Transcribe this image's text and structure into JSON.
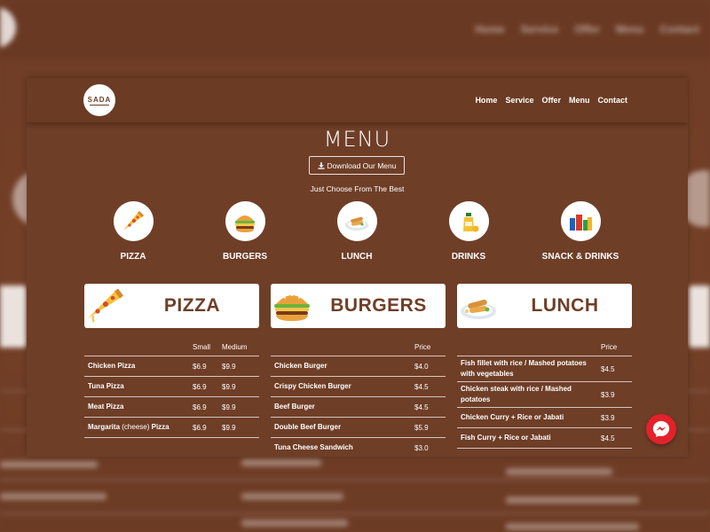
{
  "brand": {
    "logo_text": "SADA"
  },
  "nav": [
    "Home",
    "Service",
    "Offer",
    "Menu",
    "Contact"
  ],
  "menu_title": "MENU",
  "download_label": "Download Our Menu",
  "subtitle": "Just Choose From The Best",
  "categories": [
    {
      "label": "PIZZA",
      "icon": "pizza-icon"
    },
    {
      "label": "BURGERS",
      "icon": "burger-icon"
    },
    {
      "label": "LUNCH",
      "icon": "lunch-icon"
    },
    {
      "label": "DRINKS",
      "icon": "drinks-icon"
    },
    {
      "label": "SNACK & DRINKS",
      "icon": "snacks-icon"
    }
  ],
  "sections": {
    "pizza": {
      "title": "PIZZA",
      "headers": [
        "Small",
        "Medium"
      ],
      "items": [
        {
          "name": "Chicken Pizza",
          "small": "$6.9",
          "medium": "$9.9"
        },
        {
          "name": "Tuna Pizza",
          "small": "$6.9",
          "medium": "$9.9"
        },
        {
          "name": "Meat Pizza",
          "small": "$6.9",
          "medium": "$9.9"
        },
        {
          "name_bold": "Margarita",
          "name_thin": "(cheese)",
          "name_tail": "Pizza",
          "small": "$6.9",
          "medium": "$9.9"
        }
      ]
    },
    "burgers": {
      "title": "BURGERS",
      "header": "Price",
      "items": [
        {
          "name": "Chicken Burger",
          "price": "$4.0"
        },
        {
          "name": "Crispy Chicken Burger",
          "price": "$4.5"
        },
        {
          "name": "Beef Burger",
          "price": "$4.5"
        },
        {
          "name": "Double Beef Burger",
          "price": "$5.9"
        },
        {
          "name": "Tuna Cheese Sandwich",
          "price": "$3.0"
        }
      ]
    },
    "lunch": {
      "title": "LUNCH",
      "header": "Price",
      "items": [
        {
          "name": "Fish fillet with rice / Mashed potatoes with vegetables",
          "price": "$4.5"
        },
        {
          "name": "Chicken steak with rice / Mashed potatoes",
          "price": "$3.9"
        },
        {
          "name": "Chicken Curry + Rice or Jabati",
          "price": "$3.9"
        },
        {
          "name": "Fish Curry + Rice or Jabati",
          "price": "$4.5"
        }
      ]
    }
  },
  "colors": {
    "background": "#6f3e27",
    "accent_red": "#e4212b",
    "card": "#ffffff"
  }
}
